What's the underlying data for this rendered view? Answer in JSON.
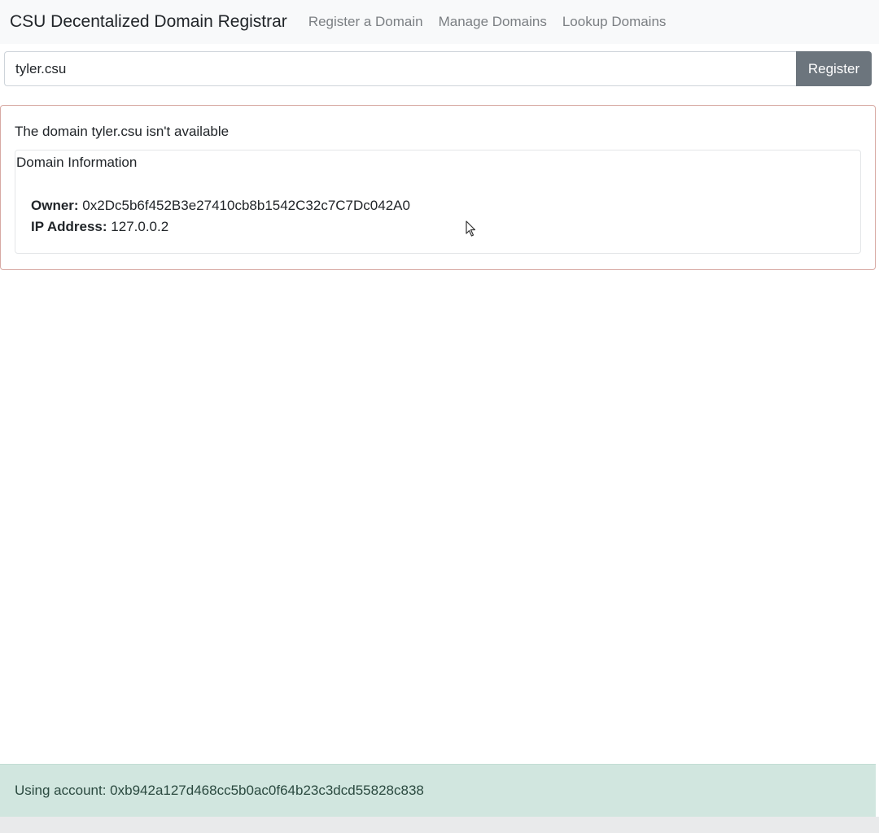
{
  "navbar": {
    "brand": "CSU Decentalized Domain Registrar",
    "links": [
      {
        "label": "Register a Domain"
      },
      {
        "label": "Manage Domains"
      },
      {
        "label": "Lookup Domains"
      }
    ]
  },
  "register_form": {
    "domain_value": "tyler.csu",
    "button_label": "Register"
  },
  "result": {
    "message": "The domain tyler.csu isn't available",
    "info_title": "Domain Information",
    "owner_label": "Owner:",
    "owner_value": "0x2Dc5b6f452B3e27410cb8b1542C32c7C7Dc042A0",
    "ip_label": "IP Address:",
    "ip_value": "127.0.0.2"
  },
  "footer": {
    "account_text": "Using account: 0xb942a127d468cc5b0ac0f64b23c3dcd55828c838"
  },
  "icons": {
    "cursor": "mouse-pointer-icon"
  },
  "colors": {
    "navbar_bg": "#f8f9fa",
    "button_bg": "#6c757d",
    "error_border": "#d7a9a3",
    "footer_bg": "#d1e6df"
  }
}
